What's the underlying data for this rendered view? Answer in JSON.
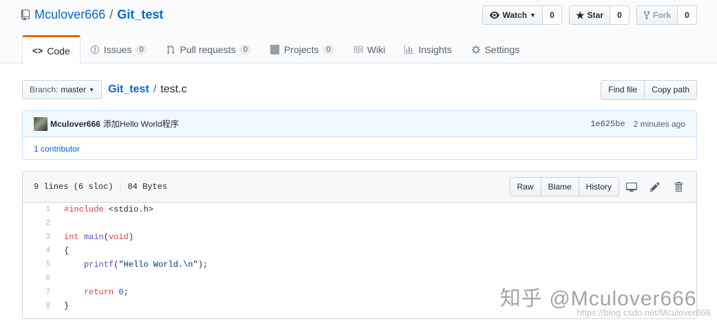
{
  "header": {
    "owner": "Mculover666",
    "separator": "/",
    "repo": "Git_test",
    "watch": {
      "label": "Watch",
      "count": "0"
    },
    "star": {
      "label": "Star",
      "count": "0"
    },
    "fork": {
      "label": "Fork",
      "count": "0"
    }
  },
  "tabs": [
    {
      "label": "Code",
      "icon": "code-icon"
    },
    {
      "label": "Issues",
      "count": "0",
      "icon": "issue-icon"
    },
    {
      "label": "Pull requests",
      "count": "0",
      "icon": "pull-request-icon"
    },
    {
      "label": "Projects",
      "count": "0",
      "icon": "project-icon"
    },
    {
      "label": "Wiki",
      "icon": "wiki-icon"
    },
    {
      "label": "Insights",
      "icon": "graph-icon"
    },
    {
      "label": "Settings",
      "icon": "gear-icon"
    }
  ],
  "file_nav": {
    "branch_label": "Branch:",
    "branch": "master",
    "path_repo": "Git_test",
    "path_sep": "/",
    "path_file": "test.c",
    "find_file": "Find file",
    "copy_path": "Copy path"
  },
  "commit": {
    "author": "Mculover666",
    "message": "添加Hello World程序",
    "sha": "1e625be",
    "time": "2 minutes ago",
    "contributors": "1 contributor"
  },
  "file": {
    "lines_info": "9 lines (6 sloc)",
    "size": "84 Bytes",
    "raw": "Raw",
    "blame": "Blame",
    "history": "History",
    "line_numbers": [
      "1",
      "2",
      "3",
      "4",
      "5",
      "6",
      "7",
      "8"
    ]
  },
  "watermark": {
    "zhihu": "知乎 @Mculover666",
    "url": "https://blog.csdn.net/Mculover666"
  },
  "colors": {
    "accent": "#e36209",
    "link": "#0366d6",
    "keyword": "#d73a49",
    "function": "#6f42c1",
    "string": "#032f62"
  }
}
